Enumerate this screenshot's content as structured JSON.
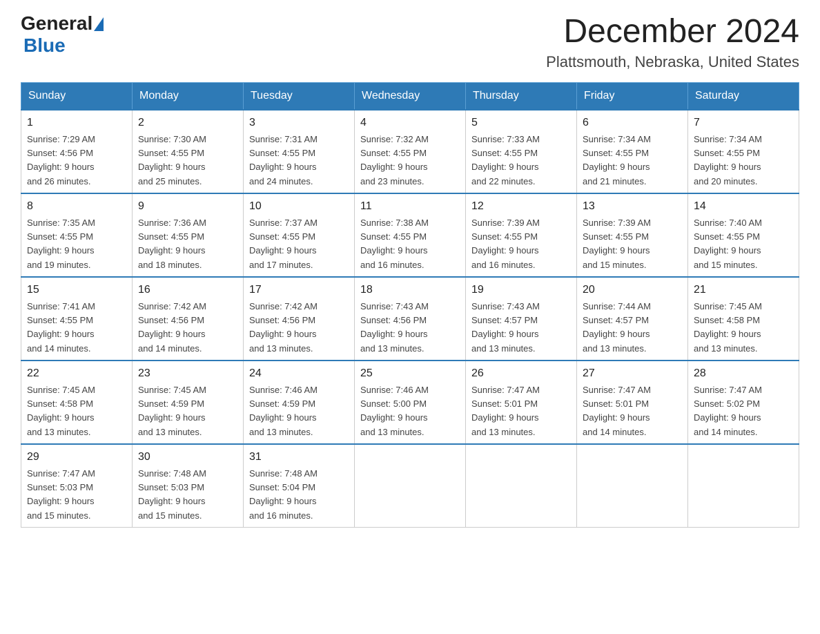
{
  "logo": {
    "general": "General",
    "triangle": "",
    "blue": "Blue"
  },
  "title": "December 2024",
  "subtitle": "Plattsmouth, Nebraska, United States",
  "headers": [
    "Sunday",
    "Monday",
    "Tuesday",
    "Wednesday",
    "Thursday",
    "Friday",
    "Saturday"
  ],
  "weeks": [
    [
      {
        "day": "1",
        "sunrise": "7:29 AM",
        "sunset": "4:56 PM",
        "daylight": "9 hours and 26 minutes."
      },
      {
        "day": "2",
        "sunrise": "7:30 AM",
        "sunset": "4:55 PM",
        "daylight": "9 hours and 25 minutes."
      },
      {
        "day": "3",
        "sunrise": "7:31 AM",
        "sunset": "4:55 PM",
        "daylight": "9 hours and 24 minutes."
      },
      {
        "day": "4",
        "sunrise": "7:32 AM",
        "sunset": "4:55 PM",
        "daylight": "9 hours and 23 minutes."
      },
      {
        "day": "5",
        "sunrise": "7:33 AM",
        "sunset": "4:55 PM",
        "daylight": "9 hours and 22 minutes."
      },
      {
        "day": "6",
        "sunrise": "7:34 AM",
        "sunset": "4:55 PM",
        "daylight": "9 hours and 21 minutes."
      },
      {
        "day": "7",
        "sunrise": "7:34 AM",
        "sunset": "4:55 PM",
        "daylight": "9 hours and 20 minutes."
      }
    ],
    [
      {
        "day": "8",
        "sunrise": "7:35 AM",
        "sunset": "4:55 PM",
        "daylight": "9 hours and 19 minutes."
      },
      {
        "day": "9",
        "sunrise": "7:36 AM",
        "sunset": "4:55 PM",
        "daylight": "9 hours and 18 minutes."
      },
      {
        "day": "10",
        "sunrise": "7:37 AM",
        "sunset": "4:55 PM",
        "daylight": "9 hours and 17 minutes."
      },
      {
        "day": "11",
        "sunrise": "7:38 AM",
        "sunset": "4:55 PM",
        "daylight": "9 hours and 16 minutes."
      },
      {
        "day": "12",
        "sunrise": "7:39 AM",
        "sunset": "4:55 PM",
        "daylight": "9 hours and 16 minutes."
      },
      {
        "day": "13",
        "sunrise": "7:39 AM",
        "sunset": "4:55 PM",
        "daylight": "9 hours and 15 minutes."
      },
      {
        "day": "14",
        "sunrise": "7:40 AM",
        "sunset": "4:55 PM",
        "daylight": "9 hours and 15 minutes."
      }
    ],
    [
      {
        "day": "15",
        "sunrise": "7:41 AM",
        "sunset": "4:55 PM",
        "daylight": "9 hours and 14 minutes."
      },
      {
        "day": "16",
        "sunrise": "7:42 AM",
        "sunset": "4:56 PM",
        "daylight": "9 hours and 14 minutes."
      },
      {
        "day": "17",
        "sunrise": "7:42 AM",
        "sunset": "4:56 PM",
        "daylight": "9 hours and 13 minutes."
      },
      {
        "day": "18",
        "sunrise": "7:43 AM",
        "sunset": "4:56 PM",
        "daylight": "9 hours and 13 minutes."
      },
      {
        "day": "19",
        "sunrise": "7:43 AM",
        "sunset": "4:57 PM",
        "daylight": "9 hours and 13 minutes."
      },
      {
        "day": "20",
        "sunrise": "7:44 AM",
        "sunset": "4:57 PM",
        "daylight": "9 hours and 13 minutes."
      },
      {
        "day": "21",
        "sunrise": "7:45 AM",
        "sunset": "4:58 PM",
        "daylight": "9 hours and 13 minutes."
      }
    ],
    [
      {
        "day": "22",
        "sunrise": "7:45 AM",
        "sunset": "4:58 PM",
        "daylight": "9 hours and 13 minutes."
      },
      {
        "day": "23",
        "sunrise": "7:45 AM",
        "sunset": "4:59 PM",
        "daylight": "9 hours and 13 minutes."
      },
      {
        "day": "24",
        "sunrise": "7:46 AM",
        "sunset": "4:59 PM",
        "daylight": "9 hours and 13 minutes."
      },
      {
        "day": "25",
        "sunrise": "7:46 AM",
        "sunset": "5:00 PM",
        "daylight": "9 hours and 13 minutes."
      },
      {
        "day": "26",
        "sunrise": "7:47 AM",
        "sunset": "5:01 PM",
        "daylight": "9 hours and 13 minutes."
      },
      {
        "day": "27",
        "sunrise": "7:47 AM",
        "sunset": "5:01 PM",
        "daylight": "9 hours and 14 minutes."
      },
      {
        "day": "28",
        "sunrise": "7:47 AM",
        "sunset": "5:02 PM",
        "daylight": "9 hours and 14 minutes."
      }
    ],
    [
      {
        "day": "29",
        "sunrise": "7:47 AM",
        "sunset": "5:03 PM",
        "daylight": "9 hours and 15 minutes."
      },
      {
        "day": "30",
        "sunrise": "7:48 AM",
        "sunset": "5:03 PM",
        "daylight": "9 hours and 15 minutes."
      },
      {
        "day": "31",
        "sunrise": "7:48 AM",
        "sunset": "5:04 PM",
        "daylight": "9 hours and 16 minutes."
      },
      null,
      null,
      null,
      null
    ]
  ],
  "labels": {
    "sunrise": "Sunrise:",
    "sunset": "Sunset:",
    "daylight": "Daylight:"
  }
}
